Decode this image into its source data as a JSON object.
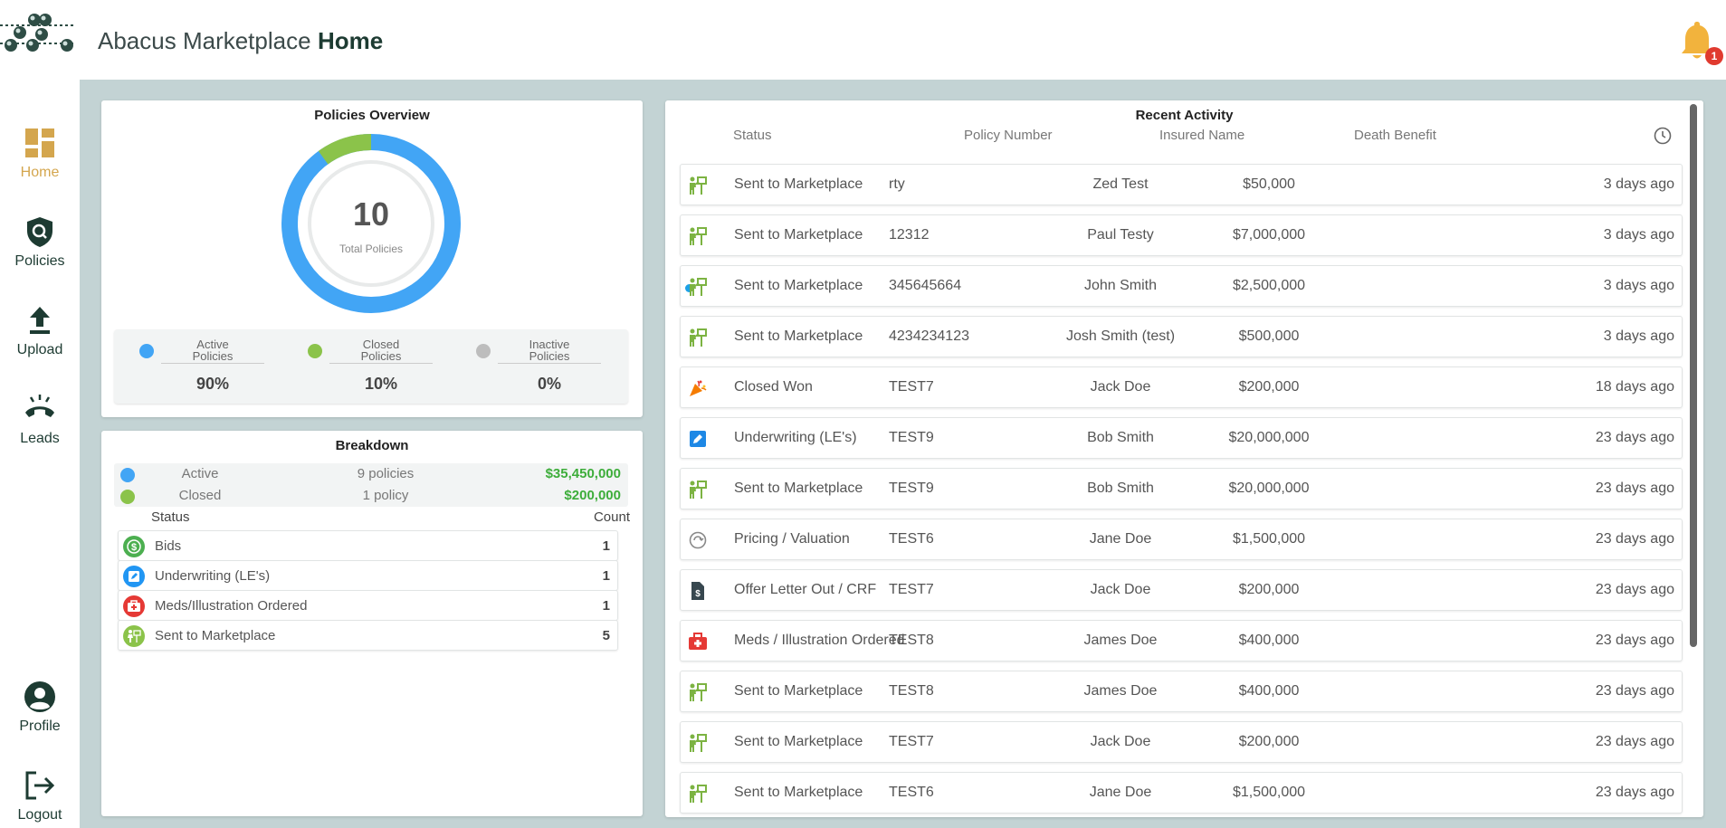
{
  "app": {
    "brand": "Abacus Marketplace",
    "page_title": "Home",
    "notifications": "1"
  },
  "nav": [
    {
      "label": "Home",
      "icon": "dashboard-icon",
      "active": true
    },
    {
      "label": "Policies",
      "icon": "policy-search-icon"
    },
    {
      "label": "Upload",
      "icon": "upload-icon"
    },
    {
      "label": "Leads",
      "icon": "phone-icon"
    },
    {
      "label": "Profile",
      "icon": "profile-icon"
    },
    {
      "label": "Logout",
      "icon": "logout-icon"
    }
  ],
  "overview": {
    "title": "Policies Overview",
    "total": "10",
    "total_label": "Total Policies",
    "active_fraction": 0.9,
    "closed_fraction": 0.1,
    "stats": [
      {
        "label_line1": "Active",
        "label_line2": "Policies",
        "pct": "90%",
        "color": "#42a5f5"
      },
      {
        "label_line1": "Closed",
        "label_line2": "Policies",
        "pct": "10%",
        "color": "#8bc34a"
      },
      {
        "label_line1": "Inactive",
        "label_line2": "Policies",
        "pct": "0%",
        "color": "#bdbdbd"
      }
    ]
  },
  "breakdown": {
    "title": "Breakdown",
    "summary": [
      {
        "name": "Active",
        "count": "9 policies",
        "amount": "$35,450,000",
        "color": "#42a5f5"
      },
      {
        "name": "Closed",
        "count": "1 policy",
        "amount": "$200,000",
        "color": "#8bc34a"
      }
    ],
    "status_header": "Status",
    "count_header": "Count",
    "items": [
      {
        "name": "Bids",
        "count": "1",
        "color": "#4caf50",
        "icon": "dollar-icon"
      },
      {
        "name": "Underwriting (LE's)",
        "count": "1",
        "color": "#2196f3",
        "icon": "edit-icon"
      },
      {
        "name": "Meds/Illustration Ordered",
        "count": "1",
        "color": "#e53935",
        "icon": "medical-kit-icon"
      },
      {
        "name": "Sent to Marketplace",
        "count": "5",
        "color": "#8bc34a",
        "icon": "marketplace-icon"
      }
    ]
  },
  "activity": {
    "title": "Recent Activity",
    "headers": {
      "status": "Status",
      "policy": "Policy Number",
      "insured": "Insured Name",
      "benefit": "Death Benefit"
    },
    "rows": [
      {
        "icon": "marketplace-icon",
        "status": "Sent to Marketplace",
        "policy": "rty",
        "insured": "Zed Test",
        "benefit": "$50,000",
        "time": "3 days ago"
      },
      {
        "icon": "marketplace-icon",
        "status": "Sent to Marketplace",
        "policy": "12312",
        "insured": "Paul Testy",
        "benefit": "$7,000,000",
        "time": "3 days ago"
      },
      {
        "icon": "marketplace-icon",
        "status": "Sent to Marketplace",
        "policy": "345645664",
        "insured": "John Smith",
        "benefit": "$2,500,000",
        "time": "3 days ago",
        "unread": true
      },
      {
        "icon": "marketplace-icon",
        "status": "Sent to Marketplace",
        "policy": "4234234123",
        "insured": "Josh Smith (test)",
        "benefit": "$500,000",
        "time": "3 days ago"
      },
      {
        "icon": "party-popper-icon",
        "status": "Closed Won",
        "policy": "TEST7",
        "insured": "Jack Doe",
        "benefit": "$200,000",
        "time": "18 days ago"
      },
      {
        "icon": "edit-icon",
        "status": "Underwriting (LE's)",
        "policy": "TEST9",
        "insured": "Bob Smith",
        "benefit": "$20,000,000",
        "time": "23 days ago"
      },
      {
        "icon": "marketplace-icon",
        "status": "Sent to Marketplace",
        "policy": "TEST9",
        "insured": "Bob Smith",
        "benefit": "$20,000,000",
        "time": "23 days ago"
      },
      {
        "icon": "valuation-icon",
        "status": "Pricing / Valuation",
        "policy": "TEST6",
        "insured": "Jane Doe",
        "benefit": "$1,500,000",
        "time": "23 days ago"
      },
      {
        "icon": "document-dollar-icon",
        "status": "Offer Letter Out / CRF",
        "policy": "TEST7",
        "insured": "Jack Doe",
        "benefit": "$200,000",
        "time": "23 days ago"
      },
      {
        "icon": "medical-kit-icon",
        "status": "Meds / Illustration Ordered",
        "policy": "TEST8",
        "insured": "James Doe",
        "benefit": "$400,000",
        "time": "23 days ago"
      },
      {
        "icon": "marketplace-icon",
        "status": "Sent to Marketplace",
        "policy": "TEST8",
        "insured": "James Doe",
        "benefit": "$400,000",
        "time": "23 days ago"
      },
      {
        "icon": "marketplace-icon",
        "status": "Sent to Marketplace",
        "policy": "TEST7",
        "insured": "Jack Doe",
        "benefit": "$200,000",
        "time": "23 days ago"
      },
      {
        "icon": "marketplace-icon",
        "status": "Sent to Marketplace",
        "policy": "TEST6",
        "insured": "Jane Doe",
        "benefit": "$1,500,000",
        "time": "23 days ago"
      }
    ]
  }
}
